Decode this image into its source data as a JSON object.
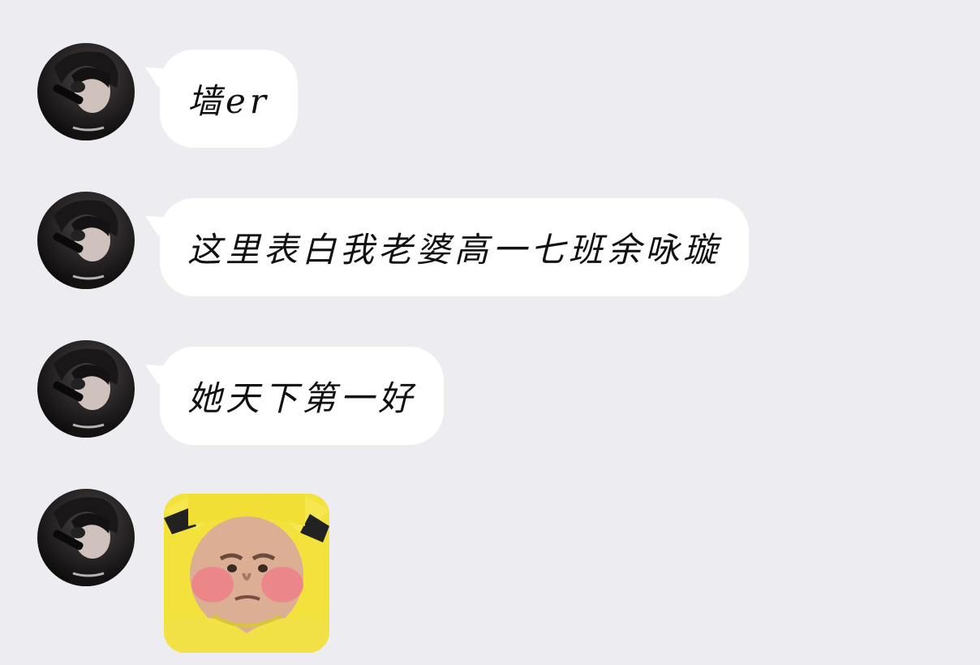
{
  "chat": {
    "messages": [
      {
        "type": "text",
        "text": "墙er"
      },
      {
        "type": "text",
        "text": "这里表白我老婆高一七班余咏璇"
      },
      {
        "type": "text",
        "text": "她天下第一好"
      },
      {
        "type": "sticker",
        "sticker": "yellow-hood-face-sticker"
      }
    ],
    "colors": {
      "background": "#ececf1",
      "bubble": "#ffffff",
      "text": "#111111"
    }
  }
}
